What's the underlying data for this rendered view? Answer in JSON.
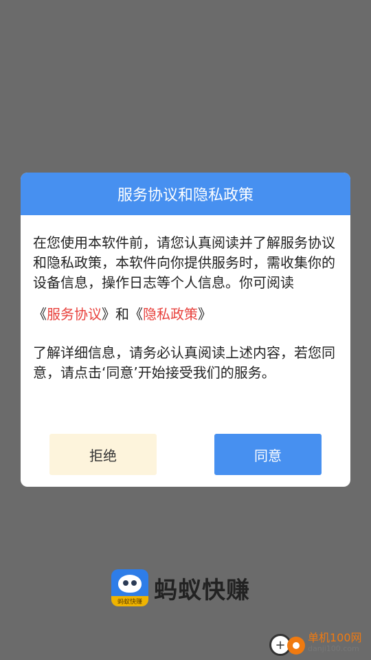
{
  "dialog": {
    "title": "服务协议和隐私政策",
    "intro": "在您使用本软件前，请您认真阅读并了解服务协议和隐私政策，本软件向你提供服务时，需收集你的设备信息，操作日志等个人信息。你可阅读",
    "links": {
      "open1": "《",
      "service_agreement": "服务协议",
      "close1": "》",
      "and": "和",
      "open2": "《",
      "privacy_policy": "隐私政策",
      "close2": "》"
    },
    "outro": "了解详细信息，请务必认真阅读上述内容，若您同意，请点击‘同意’开始接受我们的服务。",
    "decline_label": "拒绝",
    "agree_label": "同意"
  },
  "brand": {
    "name": "蚂蚁快赚",
    "logo_tag": "蚂蚁快赚"
  },
  "watermark": {
    "cn": "单机100网",
    "en": "danji100.com"
  },
  "colors": {
    "accent": "#4790f0",
    "link": "#e8413c",
    "decline_bg": "#fdf4dc",
    "overlay": "#6b6b6b"
  }
}
